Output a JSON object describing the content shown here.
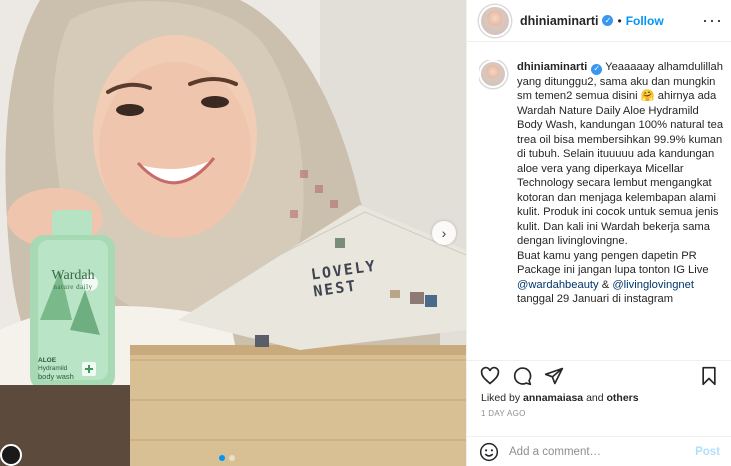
{
  "post": {
    "username": "dhiniaminarti",
    "follow_label": "Follow",
    "bullet": "•",
    "more_label": "···",
    "verified_glyph": "✓"
  },
  "photo": {
    "bottle_brand": "Wardah",
    "bottle_line": "nature daily",
    "bottle_product_1": "ALOE",
    "bottle_product_2": "Hydramild",
    "bottle_product_3": "body wash",
    "box_title_1": "LOVELY",
    "box_title_2": "NEST",
    "next_icon": "›"
  },
  "caption": {
    "username": "dhiniaminarti",
    "lines": [
      " Yeaaaaay alhamdulillah yang ditunggu2, sama aku dan mungkin sm temen2 semua disini 🤗 ahirnya ada Wardah Nature Daily Aloe Hydramild Body Wash, kandungan 100% natural tea trea oil bisa membersihkan 99.9% kuman di tubuh. Selain ituuuuu ada kandungan aloe vera yang diperkaya Micellar Technology secara lembut mengangkat kotoran dan menjaga kelembapan alami kulit. Produk ini cocok untuk semua jenis kulit. Dan kali ini Wardah bekerja sama dengan livinglovingne.",
      "Buat kamu yang pengen dapetin PR Package ini jangan lupa tonton IG Live"
    ],
    "mention_1": "@wardahbeauty",
    "ampersand": " & ",
    "mention_2": "@livinglovingnet",
    "final_line": "tanggal 29 Januari di instagram"
  },
  "engagement": {
    "liked_by_prefix": "Liked by ",
    "liked_by_user": "annamaiasa",
    "liked_by_suffix": " and ",
    "liked_by_others": "others",
    "timestamp": "1 DAY AGO"
  },
  "comment": {
    "placeholder": "Add a comment…",
    "post_label": "Post"
  },
  "colors": {
    "accent": "#0095f6",
    "post_disabled": "#b2dffc",
    "mention": "#00376b",
    "bottle_green": "#a6d9b4"
  },
  "icons": [
    "heart-icon",
    "comment-icon",
    "share-icon",
    "bookmark-icon",
    "smiley-icon",
    "verified-badge-icon",
    "more-options-icon",
    "chevron-right-icon"
  ]
}
